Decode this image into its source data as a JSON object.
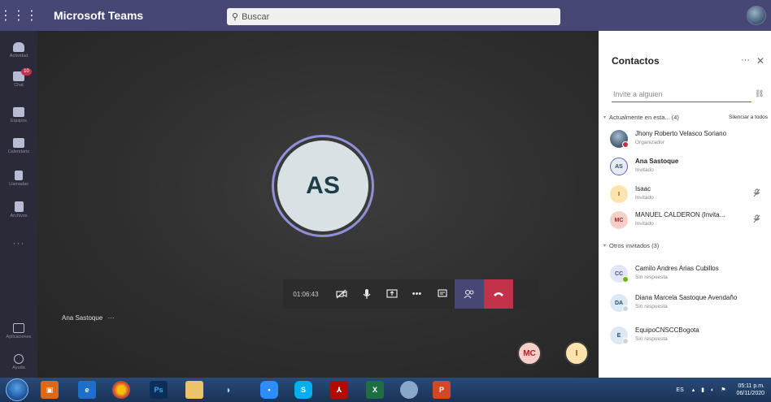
{
  "topbar": {
    "app_title": "Microsoft Teams",
    "search_placeholder": "Buscar"
  },
  "rail": {
    "items": [
      {
        "label": "Actividad",
        "icon": "bell-icon"
      },
      {
        "label": "Chat",
        "icon": "chat-icon",
        "badge": "10"
      },
      {
        "label": "Equipos",
        "icon": "teams-icon"
      },
      {
        "label": "Calendario",
        "icon": "calendar-icon"
      },
      {
        "label": "Llamadas",
        "icon": "phone-icon"
      },
      {
        "label": "Archivos",
        "icon": "files-icon"
      }
    ],
    "more": "···",
    "bottom": [
      {
        "label": "Aplicaciones",
        "icon": "apps-icon"
      },
      {
        "label": "Ayuda",
        "icon": "help-icon"
      }
    ]
  },
  "stage": {
    "main_initials": "AS",
    "name_tag": "Ana Sastoque",
    "name_tag_more": "···",
    "call_timer": "01:06:43",
    "mini_avatars": [
      "MC",
      "I"
    ]
  },
  "panel": {
    "title": "Contactos",
    "more": "···",
    "close": "✕",
    "invite_placeholder": "Invite a alguien",
    "section_current": "Actualmente en esta... (4)",
    "mute_all": "Silenciar a todos",
    "section_others": "Otros invitados (3)",
    "current": [
      {
        "initials": "",
        "name": "Jhony Roberto Velasco Soriano",
        "role": "Organizador",
        "photo": true,
        "status": "#c4314b"
      },
      {
        "initials": "AS",
        "name": "Ana Sastoque",
        "role": "Invitado",
        "bold": true
      },
      {
        "initials": "I",
        "name": "Isaac",
        "role": "Invitado",
        "muted": true
      },
      {
        "initials": "MC",
        "name": "MANUEL CALDERON (Invita...",
        "role": "Invitado",
        "muted": true
      }
    ],
    "others": [
      {
        "initials": "CC",
        "name": "Camilo Andres Arias Cubillos",
        "role": "Sin respuesta",
        "status": "#6bb700"
      },
      {
        "initials": "DA",
        "name": "Diana Marcela Sastoque Avendaño",
        "role": "Sin respuesta",
        "status": "#cfd4da"
      },
      {
        "initials": "E",
        "name": "EquipoCNSCCBogota",
        "role": "Sin respuesta",
        "status": "#cfd4da"
      }
    ]
  },
  "taskbar": {
    "lang": "ES",
    "time": "05:11 p.m.",
    "date": "06/11/2020"
  },
  "colors": {
    "teams_purple": "#464775",
    "accent": "#6264a7",
    "end_call": "#c4314b"
  }
}
